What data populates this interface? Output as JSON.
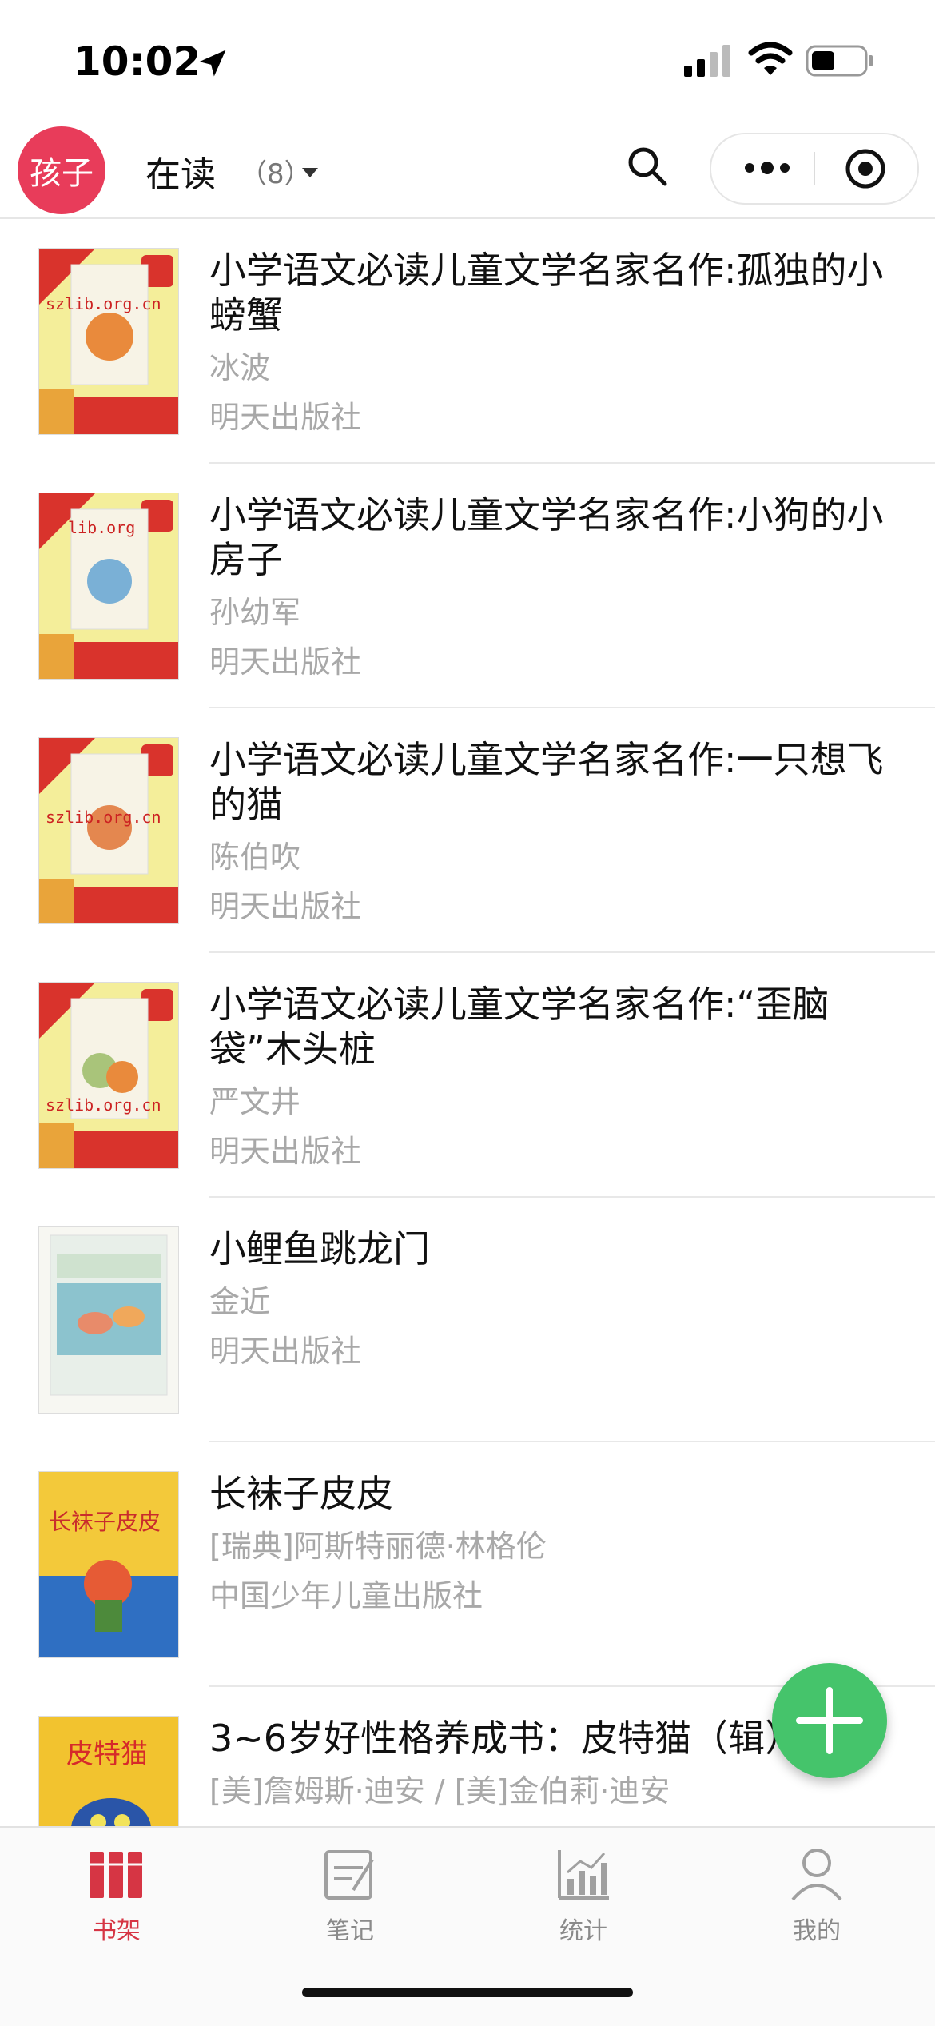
{
  "status_bar": {
    "time": "10:02"
  },
  "header": {
    "avatar_label": "孩子",
    "shelf_title": "在读",
    "shelf_count": "（8）"
  },
  "books": [
    {
      "title": "小学语文必读儿童文学名家名作:孤独的小螃蟹",
      "author": "冰波",
      "publisher": "明天出版社",
      "cover_watermark": "szlib.org.cn"
    },
    {
      "title": "小学语文必读儿童文学名家名作:小狗的小房子",
      "author": "孙幼军",
      "publisher": "明天出版社",
      "cover_watermark": "lib.org"
    },
    {
      "title": "小学语文必读儿童文学名家名作:一只想飞的猫",
      "author": "陈伯吹",
      "publisher": "明天出版社",
      "cover_watermark": "szlib.org.cn"
    },
    {
      "title": "小学语文必读儿童文学名家名作:“歪脑袋”木头桩",
      "author": "严文井",
      "publisher": "明天出版社",
      "cover_watermark": "szlib.org.cn"
    },
    {
      "title": "小鲤鱼跳龙门",
      "author": "金近",
      "publisher": "明天出版社"
    },
    {
      "title": "长袜子皮皮",
      "author": "[瑞典]阿斯特丽德·林格伦",
      "publisher": "中国少年儿童出版社",
      "cover_text": "长袜子皮皮"
    },
    {
      "title": "3~6岁好性格养成书：皮特猫（辑）",
      "author": "[美]詹姆斯·迪安 / [美]金伯莉·迪安",
      "publisher": "",
      "cover_text": "皮特猫"
    }
  ],
  "tabs": [
    {
      "label": "书架",
      "icon": "bookshelf-icon",
      "active": true
    },
    {
      "label": "笔记",
      "icon": "note-icon",
      "active": false
    },
    {
      "label": "统计",
      "icon": "chart-icon",
      "active": false
    },
    {
      "label": "我的",
      "icon": "user-icon",
      "active": false
    }
  ],
  "colors": {
    "accent": "#d63544",
    "avatar": "#e83c5a",
    "fab": "#45c46b"
  }
}
